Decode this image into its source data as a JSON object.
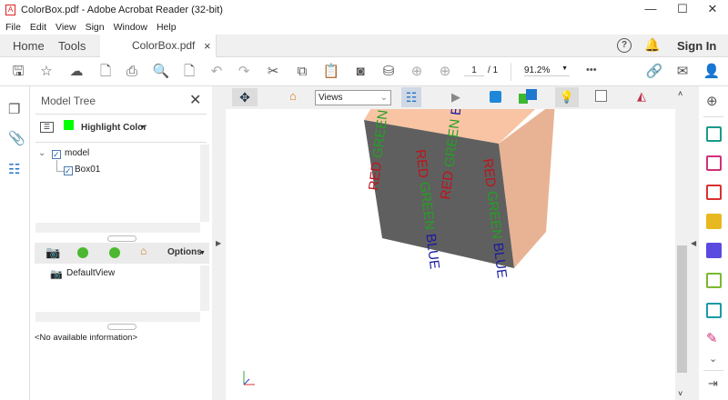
{
  "window": {
    "title": "ColorBox.pdf - Adobe Acrobat Reader (32-bit)",
    "minimize": "—",
    "maximize": "☐",
    "close": "✕"
  },
  "menu": [
    "File",
    "Edit",
    "View",
    "Sign",
    "Window",
    "Help"
  ],
  "tabs": {
    "home": "Home",
    "tools": "Tools",
    "document": "ColorBox.pdf",
    "close": "×",
    "sign_in": "Sign In"
  },
  "toolbar": {
    "page_current": "1",
    "page_total": "/ 1",
    "zoom": "91.2%",
    "more": "•••"
  },
  "model_tree": {
    "title": "Model Tree",
    "highlight_label": "Highlight Color",
    "highlight_color": "#00ff00",
    "nodes": [
      {
        "label": "model",
        "checked": true
      },
      {
        "label": "Box01",
        "checked": true
      }
    ],
    "options_label": "Options",
    "views": [
      "DefaultView"
    ],
    "info": "<No available information>"
  },
  "toolbar3d": {
    "views_select": "Views"
  },
  "cube": {
    "face_color": "#5f5f5f",
    "top_color": "#f8c4a4",
    "words": [
      {
        "text": "RED",
        "color": "#c0141c"
      },
      {
        "text": "GREEN",
        "color": "#22a022"
      },
      {
        "text": "BLUE",
        "color": "#1a1aa0"
      }
    ]
  }
}
